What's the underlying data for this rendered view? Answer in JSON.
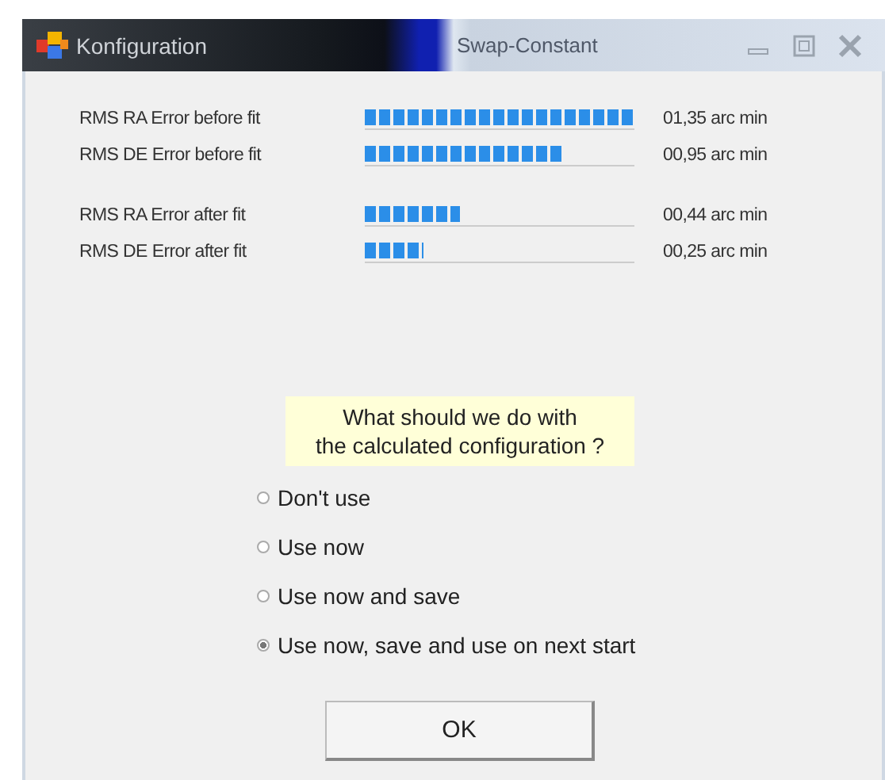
{
  "window": {
    "title": "Konfiguration",
    "background_title": "Swap-Constant"
  },
  "meter_groups": [
    {
      "meters": [
        {
          "label": "RMS RA Error before fit",
          "level": 1.0,
          "reading": "01,35 arc min"
        },
        {
          "label": "RMS DE Error before fit",
          "level": 0.73,
          "reading": "00,95 arc min"
        }
      ]
    },
    {
      "meters": [
        {
          "label": "RMS RA Error after fit",
          "level": 0.35,
          "reading": "00,44 arc min"
        },
        {
          "label": "RMS DE Error after fit",
          "level": 0.22,
          "reading": "00,25 arc min"
        }
      ]
    }
  ],
  "question": "What should we do with\nthe calculated configuration ?",
  "options": [
    {
      "label": "Don't use",
      "selected": false
    },
    {
      "label": "Use now",
      "selected": false
    },
    {
      "label": "Use now and save",
      "selected": false
    },
    {
      "label": "Use now, save and use on next start",
      "selected": true
    }
  ],
  "buttons": [
    "OK"
  ]
}
